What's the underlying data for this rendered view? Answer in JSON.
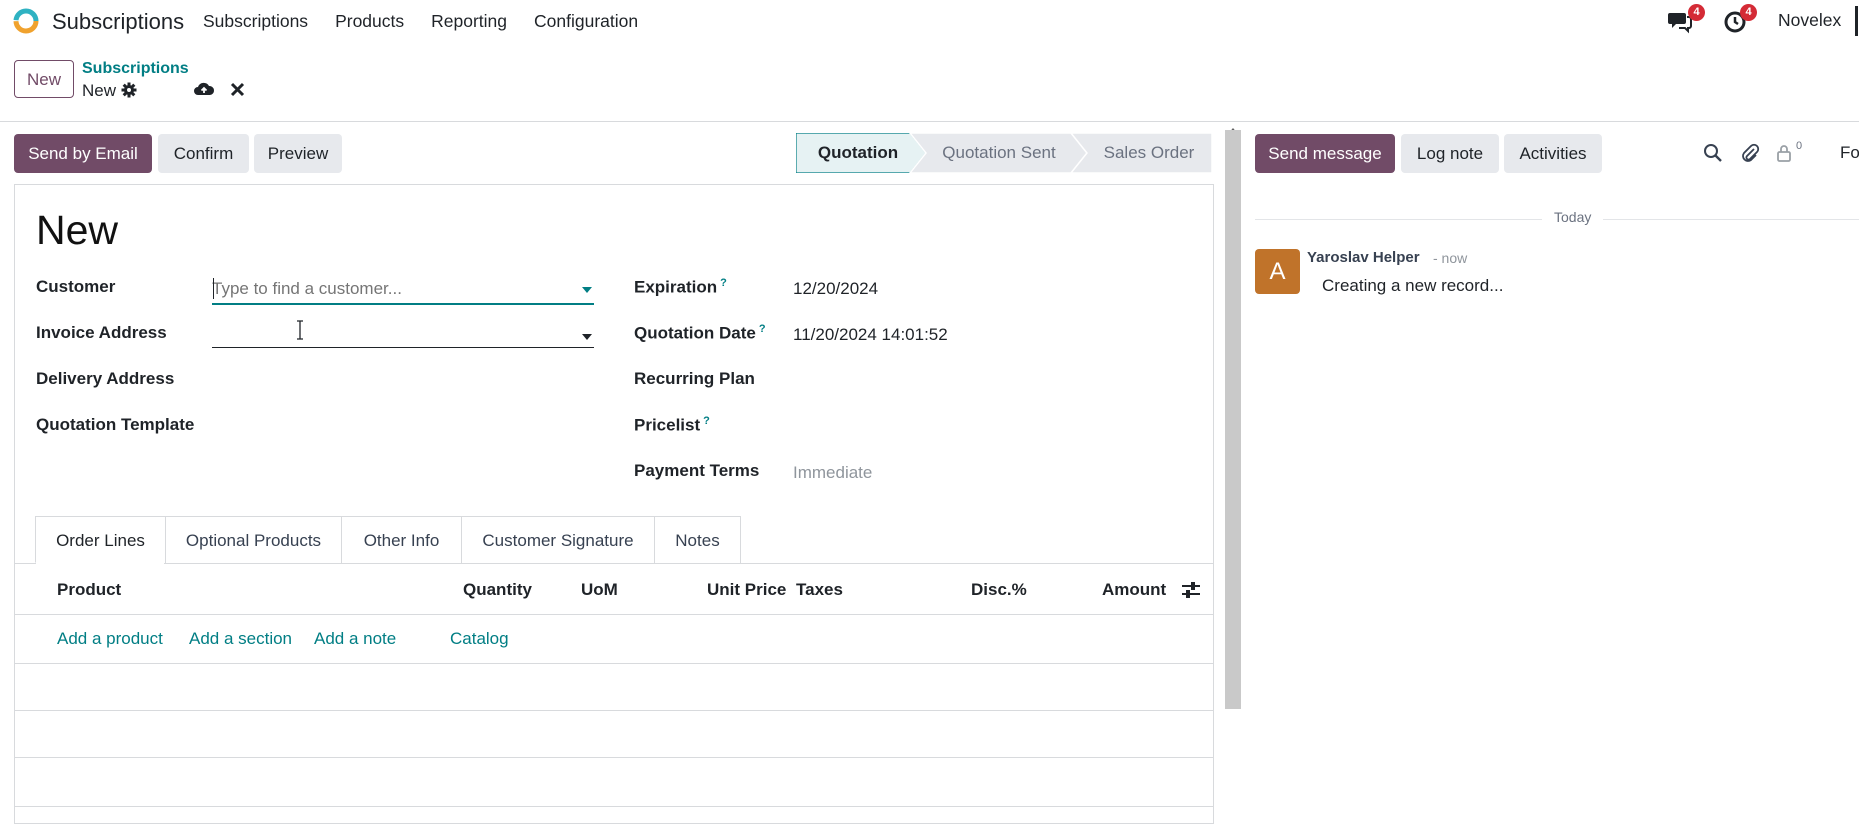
{
  "navbar": {
    "app_name": "Subscriptions",
    "menu": [
      "Subscriptions",
      "Products",
      "Reporting",
      "Configuration"
    ],
    "messages_count": "4",
    "activities_count": "4",
    "company": "Novelex"
  },
  "control_panel": {
    "new_label": "New",
    "breadcrumb_parent": "Subscriptions",
    "breadcrumb_current": "New"
  },
  "actions": {
    "send_email": "Send by Email",
    "confirm": "Confirm",
    "preview": "Preview"
  },
  "status": {
    "stages": [
      "Quotation",
      "Quotation Sent",
      "Sales Order"
    ],
    "active": "Quotation"
  },
  "form": {
    "title": "New",
    "customer_label": "Customer",
    "customer_placeholder": "Type to find a customer...",
    "invoice_address_label": "Invoice Address",
    "delivery_address_label": "Delivery Address",
    "quotation_template_label": "Quotation Template",
    "expiration_label": "Expiration",
    "expiration_value": "12/20/2024",
    "quotation_date_label": "Quotation Date",
    "quotation_date_value": "11/20/2024 14:01:52",
    "recurring_plan_label": "Recurring Plan",
    "pricelist_label": "Pricelist",
    "payment_terms_label": "Payment Terms",
    "payment_terms_placeholder": "Immediate",
    "help_mark": "?"
  },
  "tabs": [
    "Order Lines",
    "Optional Products",
    "Other Info",
    "Customer Signature",
    "Notes"
  ],
  "table": {
    "columns": [
      "Product",
      "Quantity",
      "UoM",
      "Unit Price",
      "Taxes",
      "Disc.%",
      "Amount"
    ],
    "add_links": [
      "Add a product",
      "Add a section",
      "Add a note",
      "Catalog"
    ]
  },
  "chatter": {
    "send_message": "Send message",
    "log_note": "Log note",
    "activities": "Activities",
    "followers_count": "0",
    "follow_label": "Fo",
    "today": "Today",
    "messages": [
      {
        "author": "Yaroslav Helper",
        "date": "- now",
        "body": "Creating a new record...",
        "avatar_letter": "A"
      }
    ]
  },
  "colors": {
    "primary": "#714b67",
    "link": "#017e84",
    "badge": "#d42b36",
    "active_stage": "#e6f2f3",
    "avatar": "#c0732a"
  }
}
